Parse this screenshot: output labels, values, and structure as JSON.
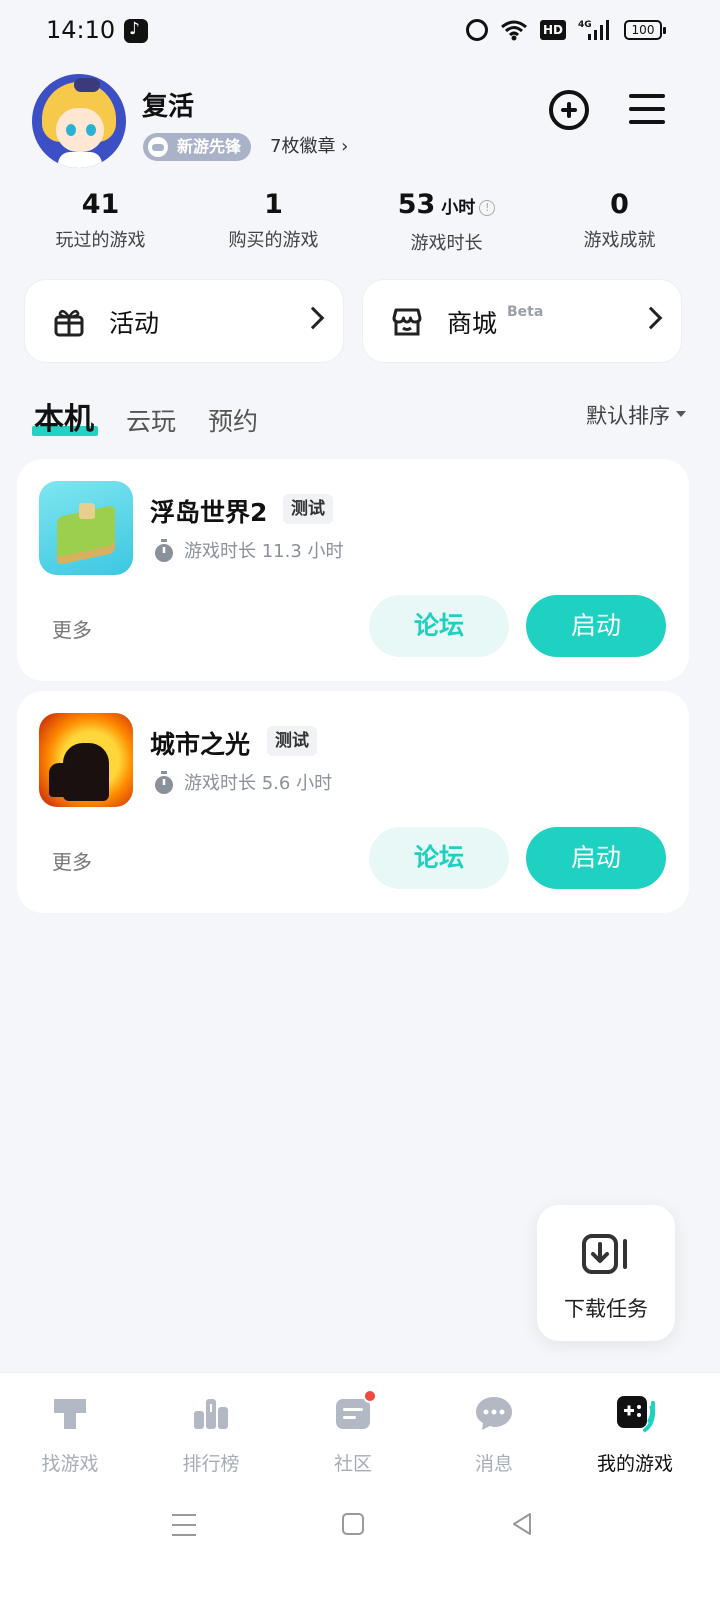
{
  "status_bar": {
    "time": "14:10",
    "hd": "HD",
    "network": "4G",
    "battery": "100"
  },
  "profile": {
    "username": "复活",
    "badge_label": "新游先锋",
    "badges_count": "7枚徽章 ›"
  },
  "stats": [
    {
      "value": "41",
      "unit": "",
      "label": "玩过的游戏"
    },
    {
      "value": "1",
      "unit": "",
      "label": "购买的游戏"
    },
    {
      "value": "53",
      "unit": "小时",
      "label": "游戏时长"
    },
    {
      "value": "0",
      "unit": "",
      "label": "游戏成就"
    }
  ],
  "quick_cards": {
    "activity": "活动",
    "shop": "商城",
    "shop_tag": "Beta"
  },
  "tabs": [
    "本机",
    "云玩",
    "预约"
  ],
  "sort_label": "默认排序",
  "games": [
    {
      "title": "浮岛世界2",
      "tag": "测试",
      "playtime": "游戏时长 11.3 小时",
      "more": "更多",
      "forum": "论坛",
      "launch": "启动"
    },
    {
      "title": "城市之光",
      "tag": "测试",
      "playtime": "游戏时长 5.6 小时",
      "more": "更多",
      "forum": "论坛",
      "launch": "启动"
    }
  ],
  "download_task": "下载任务",
  "bottom_nav": [
    {
      "label": "找游戏",
      "icon": "find-games-icon"
    },
    {
      "label": "排行榜",
      "icon": "ranking-icon"
    },
    {
      "label": "社区",
      "icon": "community-icon"
    },
    {
      "label": "消息",
      "icon": "messages-icon"
    },
    {
      "label": "我的游戏",
      "icon": "my-games-icon"
    }
  ],
  "colors": {
    "accent": "#1fd1c0",
    "background": "#f4f6f9",
    "notification": "#f0473e"
  }
}
